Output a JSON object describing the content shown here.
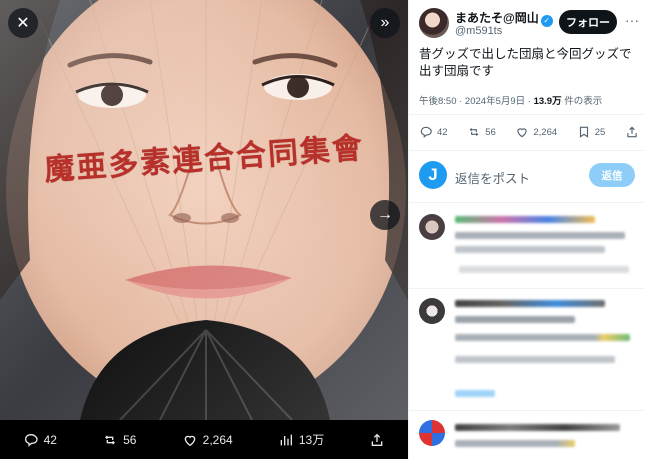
{
  "media": {
    "fan_text": "魔亜多素連合合同集會",
    "icons": {
      "close": "close-icon",
      "expand": "expand-icon",
      "next": "chevron-right-icon"
    },
    "bar": {
      "replies": "42",
      "reposts": "56",
      "likes": "2,264",
      "views": "13万"
    }
  },
  "tweet": {
    "display_name": "まあたそ@岡山",
    "handle": "@m591ts",
    "follow_label": "フォロー",
    "text": "昔グッズで出した団扇と今回グッズで出す団扇です",
    "time": "午後8:50 · 2024年5月9日 · ",
    "views_count": "13.9万",
    "views_suffix": " 件の表示",
    "actions": {
      "replies": "42",
      "reposts": "56",
      "likes": "2,264",
      "bookmarks": "25"
    }
  },
  "reply_box": {
    "avatar_letter": "J",
    "placeholder": "返信をポスト",
    "button_label": "返信"
  },
  "colors": {
    "accent": "#1d9bf0",
    "reply_button": "#8ecdf8",
    "follow_button": "#0f1419",
    "fan_text": "#b7302a"
  }
}
